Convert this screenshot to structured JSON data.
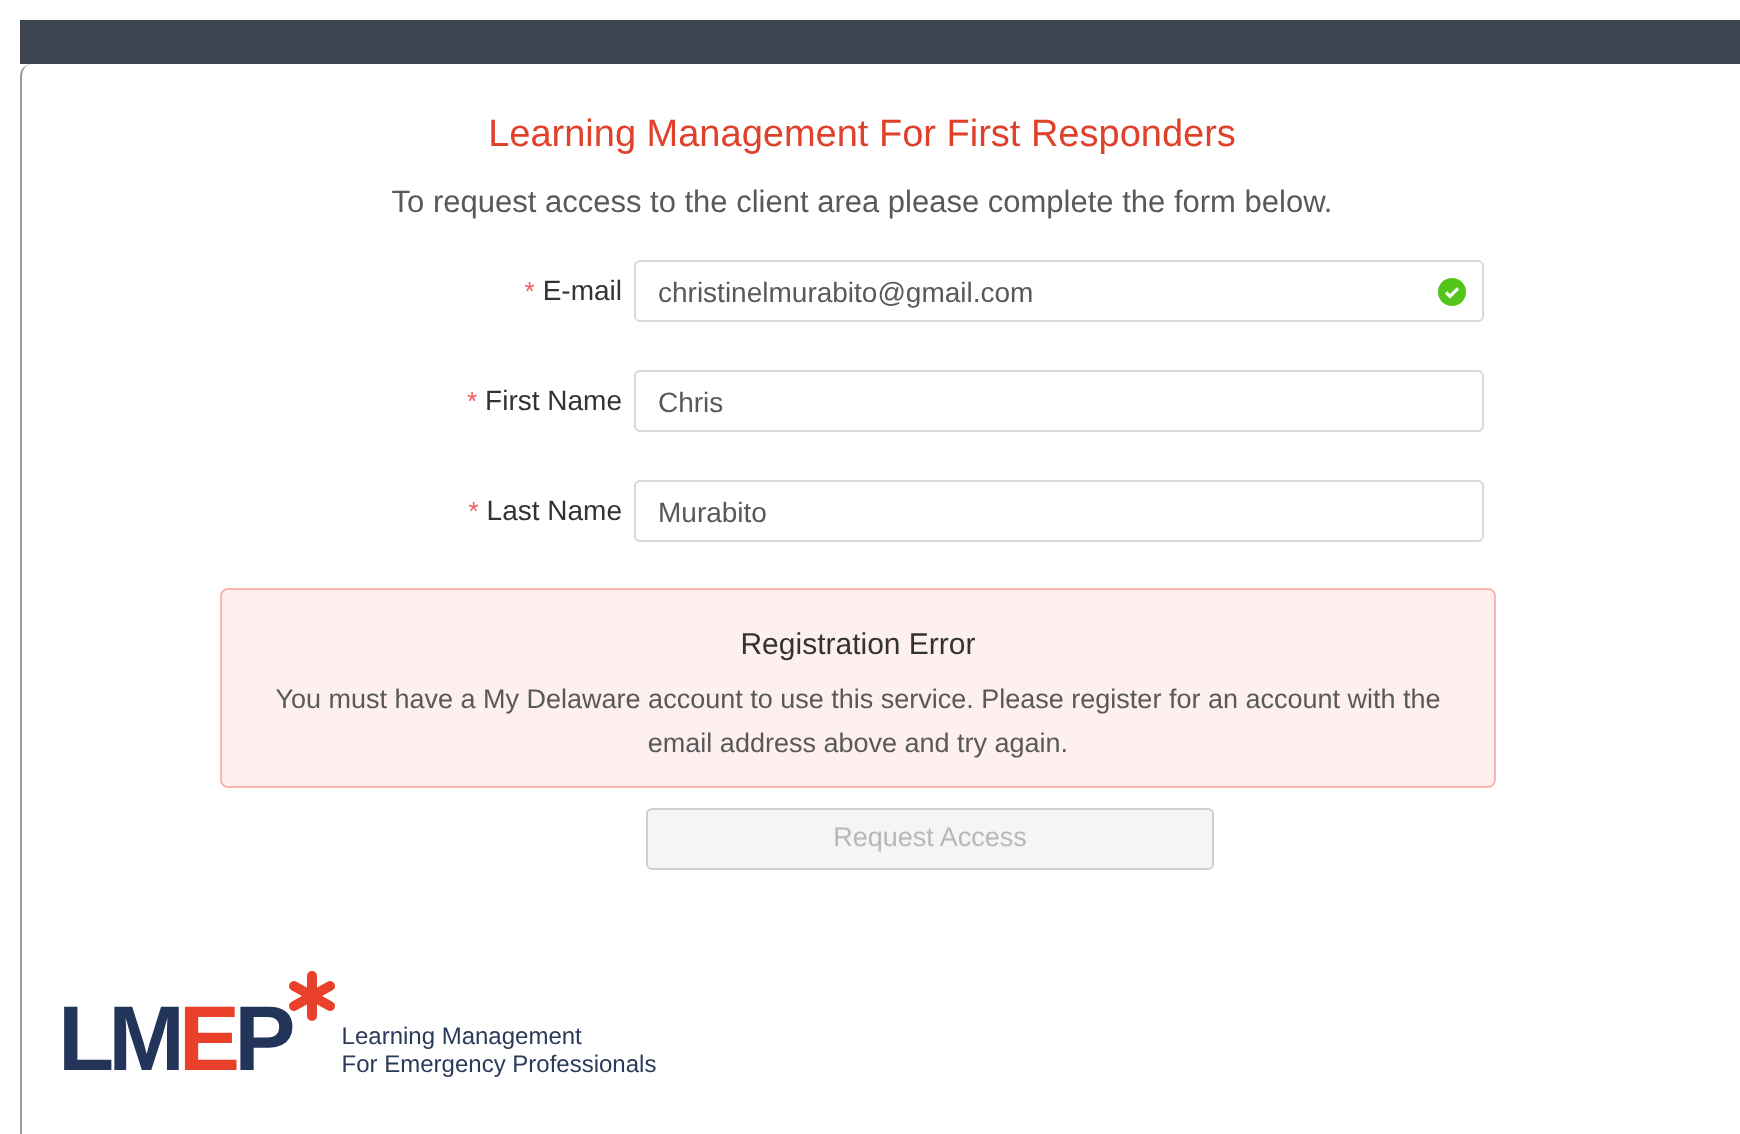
{
  "title": "Learning Management For First Responders",
  "subtitle": "To request access to the client area please complete the form below.",
  "fields": [
    {
      "required_mark": "*",
      "label": "E-mail",
      "value": "christinelmurabito@gmail.com",
      "valid": true
    },
    {
      "required_mark": "*",
      "label": "First Name",
      "value": "Chris",
      "valid": false
    },
    {
      "required_mark": "*",
      "label": "Last Name",
      "value": "Murabito",
      "valid": false
    }
  ],
  "alert": {
    "title": "Registration Error",
    "message": "You must have a My Delaware account to use this service. Please register for an account with the email address above and try again."
  },
  "submit": {
    "label": "Request Access",
    "disabled": true
  },
  "logo": {
    "letters": [
      {
        "text": "LM",
        "color": "#22345a"
      },
      {
        "text": "E",
        "color": "#e8402a"
      },
      {
        "text": "P",
        "color": "#22345a"
      }
    ],
    "tagline": [
      "Learning Management",
      "For Emergency Professionals"
    ]
  }
}
